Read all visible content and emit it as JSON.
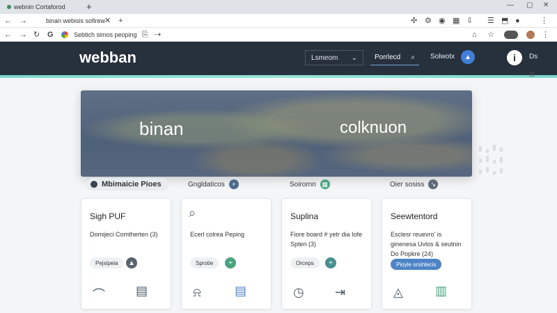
{
  "browser": {
    "tab_first_title": "webnin Cortaforod",
    "tab_active_title": "binan webisis sofirew",
    "address_text": "Sebtich simos peoping"
  },
  "site": {
    "logo": "webban",
    "nav": {
      "select_label": "Lsmeom",
      "search_label": "Porrlecd",
      "link_label": "Solwotx",
      "lang_label": "Ds"
    }
  },
  "hero": {
    "left_text": "binan",
    "right_text": "colknuon"
  },
  "sections": {
    "main_label": "Mbimaicie Pioes",
    "label_2": "Gngldaticos",
    "label_3": "Soirornn",
    "label_4": "Oier sosiss"
  },
  "cards": [
    {
      "title": "Sigh PUF",
      "text": "Domijeci Comtherten (3)",
      "button": "Pejsipeia"
    },
    {
      "title": "",
      "text": "Ecerl colrea Peping",
      "button": "Sprotie"
    },
    {
      "title": "Suplina",
      "text": "Fiore board # yetr dia Iofe Spten (3)",
      "button": "Orceps"
    },
    {
      "title": "Seewtentord",
      "text": "Esclesr reuevro' is ginenesa Uvlos & seutnin Do Popkre (24)",
      "button": "Pioyle onshlecis"
    }
  ],
  "colors": {
    "header_bg": "#27303d",
    "accent_teal": "#5fd1c2",
    "accent_blue": "#4d84c6",
    "green": "#4aa37e"
  },
  "icons": [
    "back-icon",
    "forward-icon",
    "reload-icon",
    "search-icon",
    "plus-icon",
    "calendar-icon",
    "folder-icon",
    "bell-icon",
    "clock-icon",
    "map-icon",
    "shield-icon",
    "settings-icon"
  ]
}
